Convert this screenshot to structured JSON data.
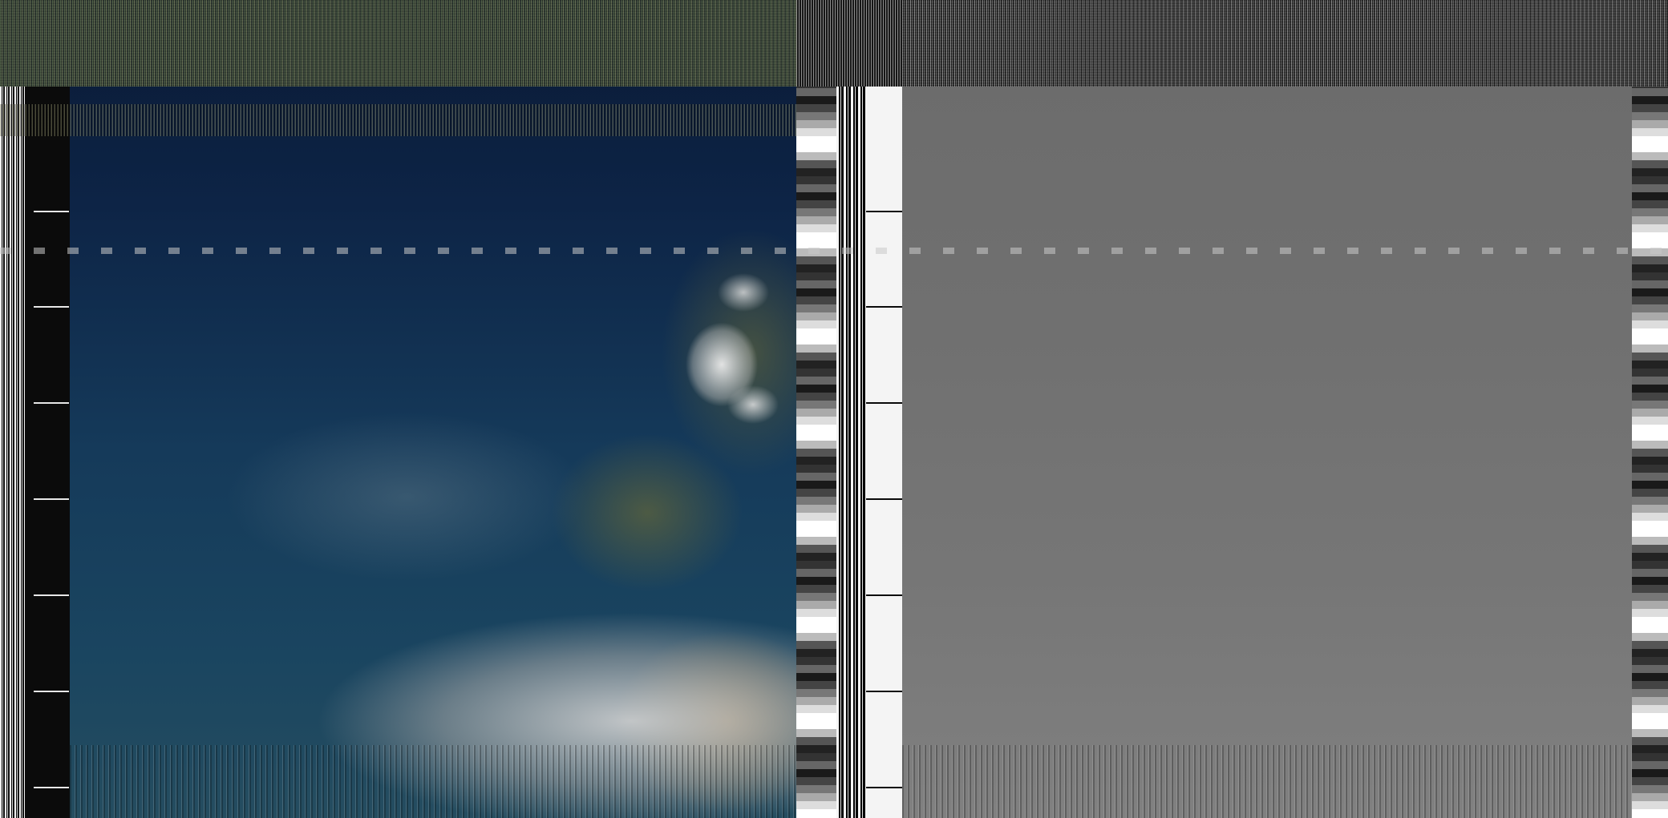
{
  "image": {
    "type": "APT satellite weather image (visible and infrared channels)",
    "channels": [
      {
        "id": "A",
        "kind": "visible",
        "dominant_colors": [
          "#0d2446",
          "#1a4560",
          "#d2d2d2",
          "#a08250"
        ]
      },
      {
        "id": "B",
        "kind": "infrared",
        "dominant_colors": [
          "#707070",
          "#f0f0f0"
        ]
      }
    ],
    "text": []
  }
}
